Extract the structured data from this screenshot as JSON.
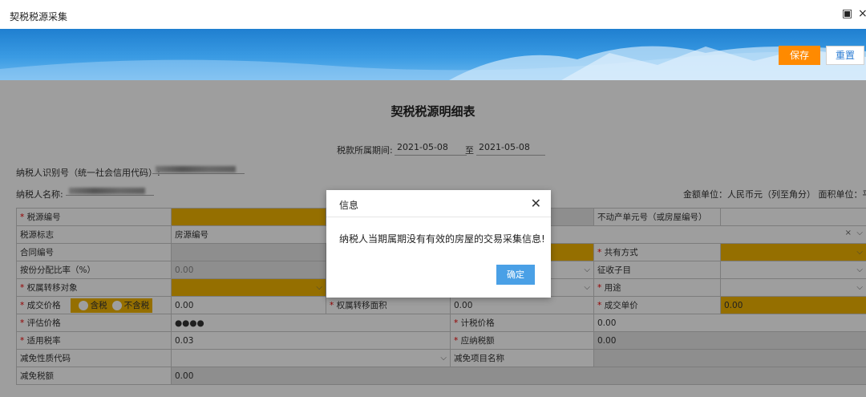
{
  "window": {
    "title": "契税税源采集"
  },
  "toolbar": {
    "save_label": "保存",
    "reset_label": "重置"
  },
  "form": {
    "title": "契税税源明细表",
    "period_label": "税款所属期间:",
    "period_start": "2021-05-08",
    "period_sep": "至",
    "period_end": "2021-05-08",
    "taxpayer_id_label": "纳税人识别号（统一社会信用代码）:",
    "taxpayer_name_label": "纳税人名称:",
    "units_note": "金额单位：人民币元（列至角分）  面积单位：平方米"
  },
  "table": {
    "source_no_label": "税源编号",
    "property_unit_label": "不动产单元号（或房屋编号）",
    "source_flag_label": "税源标志",
    "source_flag_value": "房源编号",
    "contract_no_label": "合同编号",
    "co_owner_label": "共有方式",
    "share_ratio_label": "按份分配比率（%）",
    "share_ratio_value": "0.00",
    "levy_item_label": "征收子目",
    "transfer_object_label": "权属转移对象",
    "usage_label": "用途",
    "deal_price_label": "成交价格",
    "tax_incl_label": "含税",
    "tax_excl_label": "不含税",
    "deal_price_value": "0.00",
    "transfer_area_label": "权属转移面积",
    "transfer_area_value": "0.00",
    "unit_price_label": "成交单价",
    "unit_price_value": "0.00",
    "assessed_price_label": "评估价格",
    "assessed_price_value": "●●●●",
    "taxable_price_label": "计税价格",
    "taxable_price_value": "0.00",
    "tax_rate_label": "适用税率",
    "tax_rate_value": "0.03",
    "tax_payable_label": "应纳税额",
    "tax_payable_value": "0.00",
    "reduction_code_label": "减免性质代码",
    "reduction_item_label": "减免项目名称",
    "reduction_amount_label": "减免税额",
    "reduction_amount_value": "0.00"
  },
  "dialog": {
    "title": "信息",
    "message": "纳税人当期属期没有有效的房屋的交易采集信息!",
    "ok_label": "确定"
  },
  "icons": {
    "restore": "restore-icon",
    "close": "close-icon",
    "chevron": "chevron-down-icon"
  },
  "colors": {
    "accent_orange": "#ff8a00",
    "required_yellow": "#f0b400",
    "dialog_button": "#4aa0e6",
    "banner_blue": "#2a8ad8"
  }
}
